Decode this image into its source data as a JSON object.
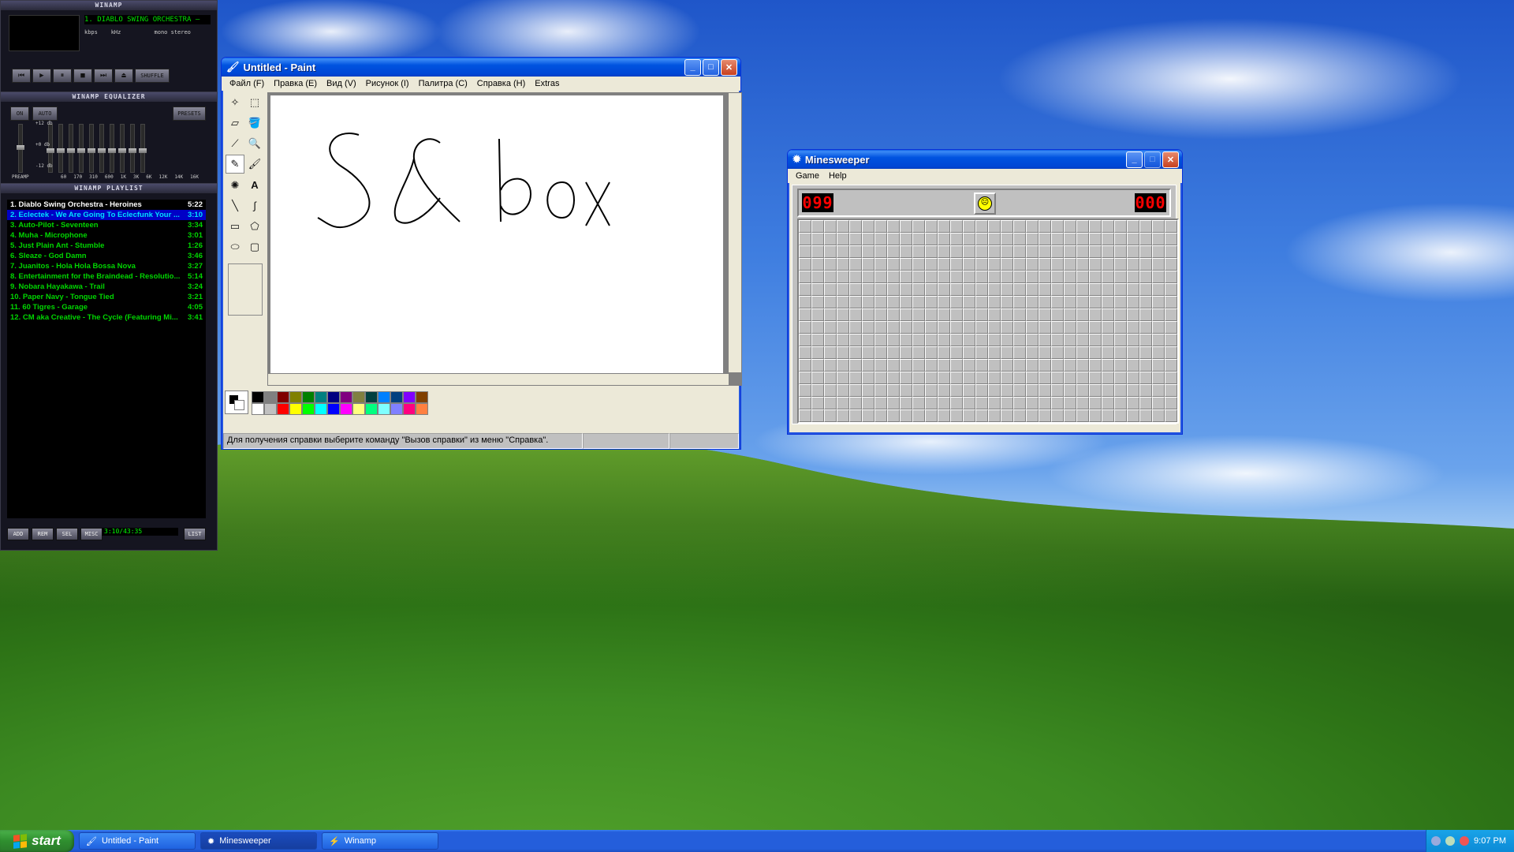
{
  "colors": {
    "xp_blue": "#0053e0",
    "start_green": "#2f8f2f",
    "paint_ink": "#000000"
  },
  "winamp": {
    "title": "WINAMP",
    "track": "1. DIABLO SWING ORCHESTRA –",
    "kbps_label": "kbps",
    "khz_label": "kHz",
    "mono": "mono",
    "stereo": "stereo",
    "shuffle": "SHUFFLE",
    "eq_title": "WINAMP EQUALIZER",
    "eq_on": "ON",
    "eq_auto": "AUTO",
    "eq_presets": "PRESETS",
    "eq_db": [
      "+12 db",
      "+0 db",
      "-12 db"
    ],
    "eq_preamp": "PREAMP",
    "eq_bands": [
      "60",
      "170",
      "310",
      "600",
      "1K",
      "3K",
      "6K",
      "12K",
      "14K",
      "16K"
    ],
    "pl_title": "WINAMP PLAYLIST",
    "playlist": [
      {
        "title": "1. Diablo Swing Orchestra - Heroines",
        "time": "5:22"
      },
      {
        "title": "2. Eclectek - We Are Going To Eclecfunk Your ...",
        "time": "3:10"
      },
      {
        "title": "3. Auto-Pilot - Seventeen",
        "time": "3:34"
      },
      {
        "title": "4. Muha - Microphone",
        "time": "3:01"
      },
      {
        "title": "5. Just Plain Ant - Stumble",
        "time": "1:26"
      },
      {
        "title": "6. Sleaze - God Damn",
        "time": "3:46"
      },
      {
        "title": "7. Juanitos - Hola Hola Bossa Nova",
        "time": "3:27"
      },
      {
        "title": "8. Entertainment for the Braindead - Resolutio...",
        "time": "5:14"
      },
      {
        "title": "9. Nobara Hayakawa - Trail",
        "time": "3:24"
      },
      {
        "title": "10. Paper Navy - Tongue Tied",
        "time": "3:21"
      },
      {
        "title": "11. 60 Tigres - Garage",
        "time": "4:05"
      },
      {
        "title": "12. CM aka Creative - The Cycle (Featuring Mi...",
        "time": "3:41"
      }
    ],
    "pl_buttons": [
      "ADD",
      "REM",
      "SEL",
      "MISC"
    ],
    "pl_time": "3:10/43:35",
    "pl_list_btn": "LIST"
  },
  "paint": {
    "title": "Untitled - Paint",
    "menu": [
      "Файл (F)",
      "Правка (E)",
      "Вид (V)",
      "Рисунок (I)",
      "Палитра (C)",
      "Справка (H)",
      "Extras"
    ],
    "status": "Для получения справки выберите команду \"Вызов справки\" из меню \"Справка\".",
    "palette": [
      "#000000",
      "#808080",
      "#800000",
      "#808000",
      "#008000",
      "#008080",
      "#000080",
      "#800080",
      "#808040",
      "#004040",
      "#0080ff",
      "#004080",
      "#8000ff",
      "#804000",
      "#ffffff",
      "#c0c0c0",
      "#ff0000",
      "#ffff00",
      "#00ff00",
      "#00ffff",
      "#0000ff",
      "#ff00ff",
      "#ffff80",
      "#00ff80",
      "#80ffff",
      "#8080ff",
      "#ff0080",
      "#ff8040"
    ]
  },
  "minesweeper": {
    "title": "Minesweeper",
    "menu": [
      "Game",
      "Help"
    ],
    "mines_left": "099",
    "timer": "000",
    "face": "☹"
  },
  "taskbar": {
    "start": "start",
    "items": [
      "Untitled - Paint",
      "Minesweeper",
      "Winamp"
    ],
    "clock": "9:07 PM"
  }
}
